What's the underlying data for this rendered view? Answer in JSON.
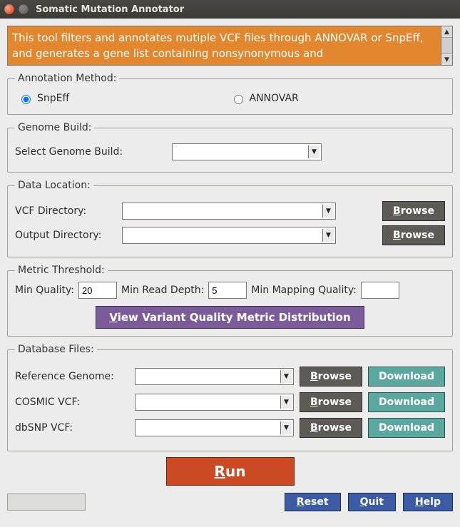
{
  "window": {
    "title": "Somatic Mutation Annotator"
  },
  "description": "This tool filters and annotates mutiple VCF files through ANNOVAR or SnpEff, and generates a gene list containing nonsynonymous and",
  "annotation_method": {
    "legend": "Annotation Method:",
    "option1": "SnpEff",
    "option2": "ANNOVAR",
    "selected": "SnpEff"
  },
  "genome_build": {
    "legend": "Genome Build:",
    "label": "Select Genome Build:",
    "value": ""
  },
  "data_location": {
    "legend": "Data Location:",
    "vcf_label": "VCF Directory:",
    "vcf_value": "",
    "out_label": "Output Directory:",
    "out_value": "",
    "browse": "Browse"
  },
  "metric": {
    "legend": "Metric Threshold:",
    "min_quality_label": "Min Quality:",
    "min_quality_value": "20",
    "min_read_depth_label": "Min Read Depth:",
    "min_read_depth_value": "5",
    "min_mapq_label": "Min Mapping Quality:",
    "min_mapq_value": "",
    "view_button": "View Variant Quality Metric Distribution"
  },
  "database": {
    "legend": "Database Files:",
    "ref_label": "Reference Genome:",
    "ref_value": "",
    "cosmic_label": "COSMIC VCF:",
    "cosmic_value": "",
    "dbsnp_label": "dbSNP VCF:",
    "dbsnp_value": "",
    "browse": "Browse",
    "download": "Download"
  },
  "actions": {
    "run": "Run",
    "reset": "Reset",
    "quit": "Quit",
    "help": "Help"
  },
  "status": ""
}
